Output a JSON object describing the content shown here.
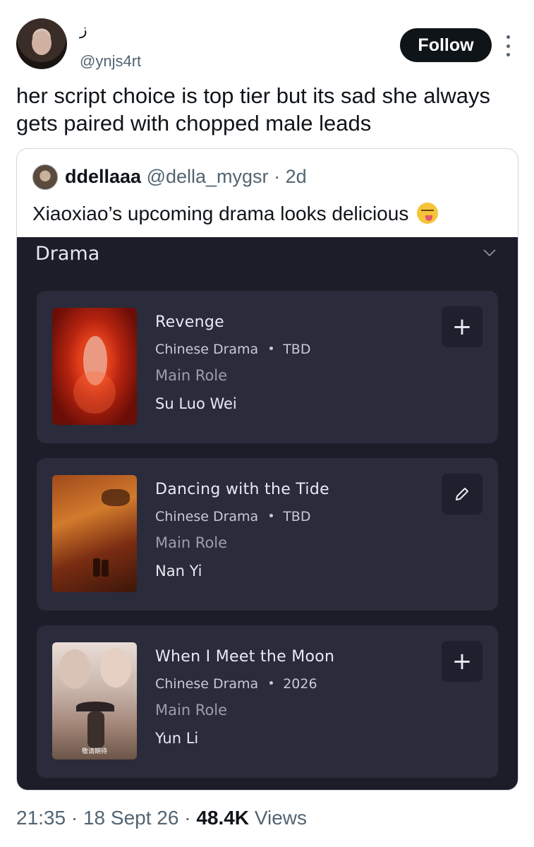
{
  "author": {
    "display_name": "ز",
    "handle": "@ynjs4rt",
    "follow_label": "Follow"
  },
  "tweet": {
    "text": "her script choice is top tier but its sad she always gets paired with chopped male leads"
  },
  "quote": {
    "name": "ddellaaa",
    "handle": "@della_mygsr",
    "separator": "·",
    "age": "2d",
    "text": "Xiaoxiao’s upcoming drama looks delicious"
  },
  "drama_list": {
    "header": "Drama",
    "items": [
      {
        "title": "Revenge",
        "type": "Chinese Drama",
        "year": "TBD",
        "role": "Main Role",
        "character": "Su Luo Wei",
        "action": "+",
        "action_icon": "plus-icon"
      },
      {
        "title": "Dancing with the Tide",
        "type": "Chinese Drama",
        "year": "TBD",
        "role": "Main Role",
        "character": "Nan Yi",
        "action": "",
        "action_icon": "pencil-icon"
      },
      {
        "title": "When I Meet the Moon",
        "type": "Chinese Drama",
        "year": "2026",
        "role": "Main Role",
        "character": "Yun Li",
        "action": "+",
        "action_icon": "plus-icon",
        "poster_label": "敬请期待"
      }
    ]
  },
  "footer": {
    "time": "21:35",
    "date": "18 Sept 26",
    "views_count": "48.4K",
    "views_label": "Views"
  },
  "colors": {
    "follow_bg": "#0f1419",
    "card_bg": "#2a2b3b",
    "panel_bg": "#1c1d29",
    "muted_text": "#536471"
  }
}
